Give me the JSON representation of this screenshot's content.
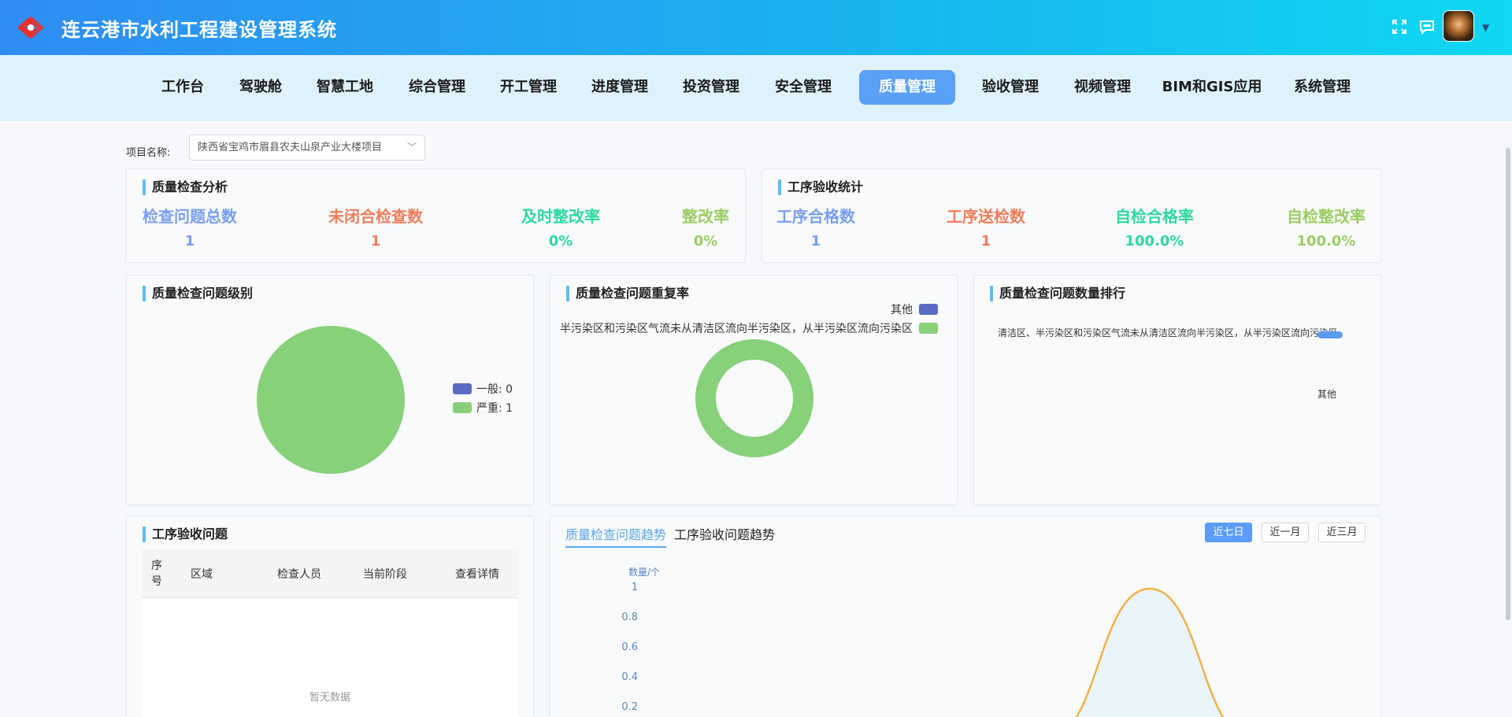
{
  "app": {
    "title": "连云港市水利工程建设管理系统"
  },
  "nav": [
    {
      "label": "工作台",
      "active": false
    },
    {
      "label": "驾驶舱",
      "active": false
    },
    {
      "label": "智慧工地",
      "active": false
    },
    {
      "label": "综合管理",
      "active": false
    },
    {
      "label": "开工管理",
      "active": false
    },
    {
      "label": "进度管理",
      "active": false
    },
    {
      "label": "投资管理",
      "active": false
    },
    {
      "label": "安全管理",
      "active": false
    },
    {
      "label": "质量管理",
      "active": true
    },
    {
      "label": "验收管理",
      "active": false
    },
    {
      "label": "视频管理",
      "active": false
    },
    {
      "label": "BIM和GIS应用",
      "active": false
    },
    {
      "label": "系统管理",
      "active": false
    }
  ],
  "project": {
    "label": "项目名称:",
    "value": "陕西省宝鸡市眉县农夫山泉产业大楼项目"
  },
  "quality_analysis": {
    "title": "质量检查分析",
    "stats": [
      {
        "label": "检查问题总数",
        "value": "1",
        "color": "#7b9ef0"
      },
      {
        "label": "未闭合检查数",
        "value": "1",
        "color": "#ef7d5a"
      },
      {
        "label": "及时整改率",
        "value": "0%",
        "color": "#2fd7a0"
      },
      {
        "label": "整改率",
        "value": "0%",
        "color": "#9ccc65"
      }
    ]
  },
  "process_stats": {
    "title": "工序验收统计",
    "stats": [
      {
        "label": "工序合格数",
        "value": "1",
        "color": "#7b9ef0"
      },
      {
        "label": "工序送检数",
        "value": "1",
        "color": "#ef7d5a"
      },
      {
        "label": "自检合格率",
        "value": "100.0%",
        "color": "#2fd7a0"
      },
      {
        "label": "自检整改率",
        "value": "100.0%",
        "color": "#9ccc65"
      }
    ]
  },
  "level_card": {
    "title": "质量检查问题级别"
  },
  "repeat_card": {
    "title": "质量检查问题重复率"
  },
  "rank_card": {
    "title": "质量检查问题数量排行"
  },
  "process_issues": {
    "title": "工序验收问题",
    "columns": [
      "序号",
      "区域",
      "检查人员",
      "当前阶段",
      "查看详情"
    ],
    "empty": "暂无数据"
  },
  "trend": {
    "tabs": [
      {
        "label": "质量检查问题趋势",
        "active": true
      },
      {
        "label": "工序验收问题趋势",
        "active": false
      }
    ],
    "ranges": [
      {
        "label": "近七日",
        "active": true
      },
      {
        "label": "近一月",
        "active": false
      },
      {
        "label": "近三月",
        "active": false
      }
    ]
  },
  "colors": {
    "green": "#88d07a",
    "purple": "#5b6bc4",
    "orange": "#f0b24a",
    "blue": "#5b9bf0"
  },
  "chart_data": [
    {
      "type": "pie",
      "categories": [
        "一般",
        "严重"
      ],
      "values": [
        0,
        1
      ],
      "legend_labels": [
        "一般: 0",
        "严重: 1"
      ],
      "colors": [
        "#5b6bc4",
        "#88d07a"
      ],
      "legend": "right"
    },
    {
      "type": "pie",
      "donut": true,
      "categories": [
        "其他",
        "半污染区和污染区气流未从清洁区流向半污染区，从半污染区流向污染区"
      ],
      "legend_labels": [
        "其他",
        "半污染区和污染区气流未从清洁区流向半污染区，从半污染区流向污染区"
      ],
      "values": [
        0,
        1
      ],
      "colors": [
        "#5b6bc4",
        "#88d07a"
      ],
      "legend": "top-right"
    },
    {
      "type": "bar",
      "orientation": "horizontal",
      "categories": [
        "清洁区、半污染区和污染区气流未从清洁区流向半污染区，从半污染区流向污染区",
        "其他"
      ],
      "values": [
        1,
        0
      ],
      "colors": [
        "#5b9bf0",
        "#f0b24a"
      ]
    },
    {
      "type": "area",
      "ylabel": "数量/个",
      "ylim": [
        0,
        1
      ],
      "y_ticks": [
        "1",
        "0.8",
        "0.6",
        "0.4",
        "0.2"
      ],
      "series": [
        {
          "values": [
            0,
            0,
            0,
            1,
            0,
            0,
            0
          ]
        }
      ],
      "color": "#f0b24a"
    }
  ]
}
